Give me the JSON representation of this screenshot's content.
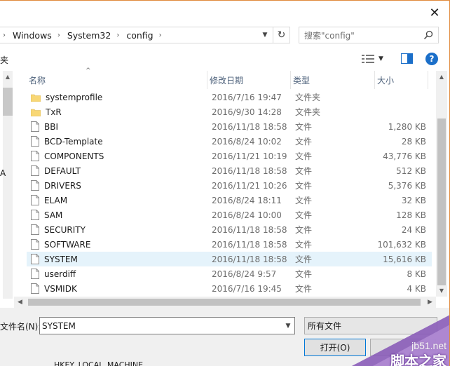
{
  "address_bar": {
    "breadcrumbs": [
      "Windows",
      "System32",
      "config"
    ]
  },
  "search": {
    "placeholder": "搜索\"config\""
  },
  "left_clip": {
    "top": "夹",
    "mid": "A"
  },
  "columns": {
    "name": "名称",
    "date": "修改日期",
    "type": "类型",
    "size": "大小"
  },
  "files": [
    {
      "name": "systemprofile",
      "date": "2016/7/16 19:47",
      "type": "文件夹",
      "size": "",
      "kind": "folder"
    },
    {
      "name": "TxR",
      "date": "2016/9/30 14:28",
      "type": "文件夹",
      "size": "",
      "kind": "folder"
    },
    {
      "name": "BBI",
      "date": "2016/11/18 18:58",
      "type": "文件",
      "size": "1,280 KB",
      "kind": "file"
    },
    {
      "name": "BCD-Template",
      "date": "2016/8/24 10:02",
      "type": "文件",
      "size": "28 KB",
      "kind": "file"
    },
    {
      "name": "COMPONENTS",
      "date": "2016/11/21 10:19",
      "type": "文件",
      "size": "43,776 KB",
      "kind": "file"
    },
    {
      "name": "DEFAULT",
      "date": "2016/11/18 18:58",
      "type": "文件",
      "size": "512 KB",
      "kind": "file"
    },
    {
      "name": "DRIVERS",
      "date": "2016/11/21 10:26",
      "type": "文件",
      "size": "5,376 KB",
      "kind": "file"
    },
    {
      "name": "ELAM",
      "date": "2016/8/24 18:11",
      "type": "文件",
      "size": "32 KB",
      "kind": "file"
    },
    {
      "name": "SAM",
      "date": "2016/8/24 10:00",
      "type": "文件",
      "size": "128 KB",
      "kind": "file"
    },
    {
      "name": "SECURITY",
      "date": "2016/11/18 18:58",
      "type": "文件",
      "size": "24 KB",
      "kind": "file"
    },
    {
      "name": "SOFTWARE",
      "date": "2016/11/18 18:58",
      "type": "文件",
      "size": "101,632 KB",
      "kind": "file"
    },
    {
      "name": "SYSTEM",
      "date": "2016/11/18 18:58",
      "type": "文件",
      "size": "15,616 KB",
      "kind": "file",
      "selected": true
    },
    {
      "name": "userdiff",
      "date": "2016/8/24 9:57",
      "type": "文件",
      "size": "8 KB",
      "kind": "file"
    },
    {
      "name": "VSMIDK",
      "date": "2016/7/16 19:45",
      "type": "文件",
      "size": "4 KB",
      "kind": "file"
    }
  ],
  "bottom": {
    "filename_label": "文件名(N):",
    "filename_value": "SYSTEM",
    "filetype_value": "所有文件",
    "open_label": "打开(O)",
    "background_text": "HKEY_LOCAL_MACHINE"
  },
  "watermark": {
    "site": "jb51.net",
    "brand": "脚本之家"
  },
  "colors": {
    "accent": "#0078d7",
    "selection": "#e5f3fb",
    "header_text": "#4c607a",
    "folder": "#f8d775",
    "help": "#1b6fc9"
  }
}
